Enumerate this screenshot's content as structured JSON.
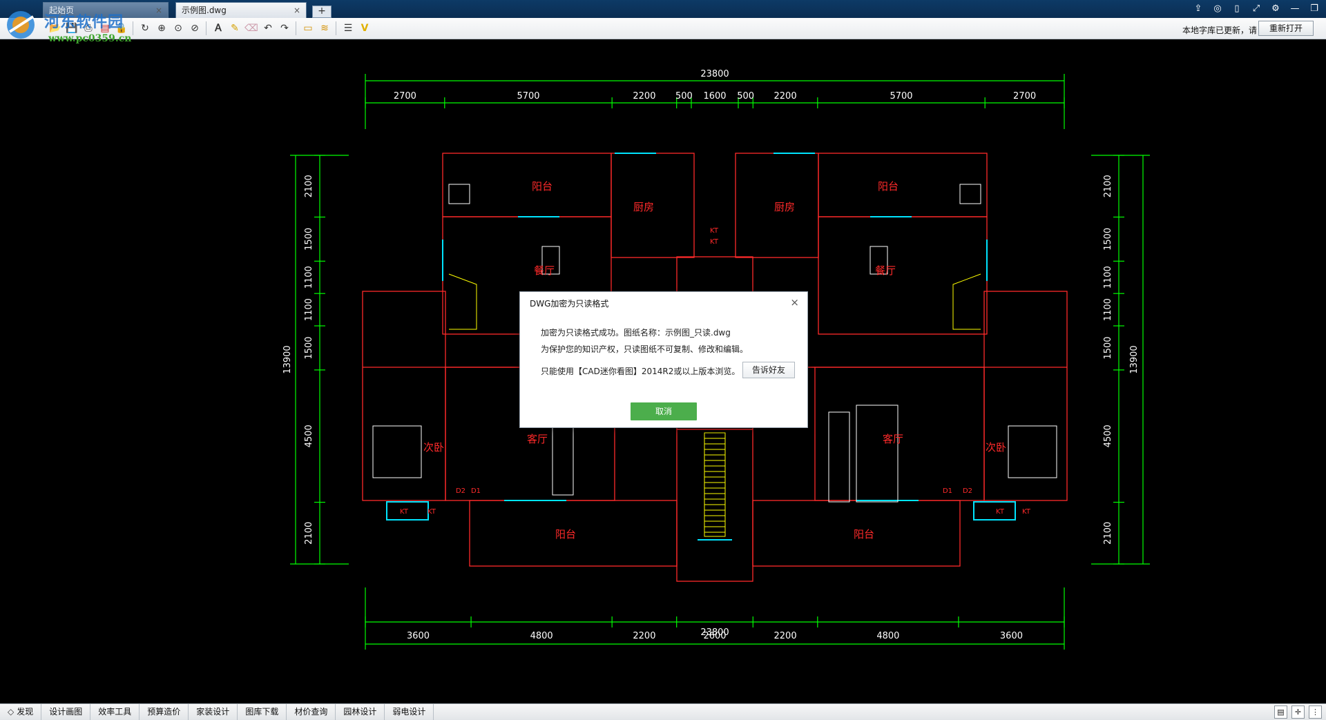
{
  "titlebar": {
    "tabs": [
      {
        "label": "起始页",
        "close": "×"
      },
      {
        "label": "示例图.dwg",
        "close": "×"
      }
    ],
    "new_tab": "+"
  },
  "watermark": {
    "title": "河东软件园",
    "url": "www.pc0359.cn"
  },
  "toolbar": {
    "notice": "本地字库已更新，请",
    "reopen": "重新打开"
  },
  "drawing": {
    "colors": {
      "background": "#000000",
      "dimension": "#00ff00",
      "wall": "#ff2a2a",
      "window": "#00e5ff",
      "furniture": "#ffffff",
      "stair": "#ffff00",
      "dim_text": "#ffffff",
      "room_text": "#ff2a2a"
    },
    "top_total": "23800",
    "top_dims": [
      "2700",
      "5700",
      "2200",
      "500",
      "1600",
      "500",
      "2200",
      "5700",
      "2700"
    ],
    "bottom_dims": [
      "3600",
      "4800",
      "2200",
      "2600",
      "2200",
      "4800",
      "3600"
    ],
    "bottom_total": "23800",
    "left_dims": [
      "2100",
      "1500",
      "1100",
      "1100",
      "1500",
      "4500",
      "2100"
    ],
    "left_total": "13900",
    "right_dims": [
      "2100",
      "1500",
      "1100",
      "1100",
      "1500",
      "4500",
      "2100"
    ],
    "right_total": "13900",
    "rooms": {
      "balcony": "阳台",
      "kitchen": "厨房",
      "dining": "餐厅",
      "living": "客厅",
      "bedroom": "次卧"
    },
    "tags": {
      "kt": "KT",
      "d1": "D1",
      "d2": "D2"
    }
  },
  "dialog": {
    "title": "DWG加密为只读格式",
    "close": "×",
    "line1": "加密为只读格式成功。图纸名称：示例图_只读.dwg",
    "line2": "为保护您的知识产权，只读图纸不可复制、修改和编辑。",
    "line3": "只能使用【CAD迷你看图】2014R2或以上版本浏览。",
    "share_button": "告诉好友",
    "cancel_button": "取消"
  },
  "bottombar": {
    "items": [
      "发现",
      "设计画图",
      "效率工具",
      "预算造价",
      "家装设计",
      "图库下载",
      "材价查询",
      "园林设计",
      "弱电设计"
    ]
  },
  "icons": {
    "toolbar": [
      "open-icon",
      "save-icon",
      "print-icon",
      "pdf-icon",
      "lock-icon",
      "rotate-icon",
      "zoom-window-icon",
      "zoom-extents-icon",
      "zoom-realtime-icon",
      "text-icon",
      "pencil-icon",
      "eraser-icon",
      "undo-icon",
      "redo-icon",
      "measure-icon",
      "hatch-icon",
      "layers-icon",
      "check-icon"
    ],
    "window": [
      "share-icon",
      "wechat-icon",
      "phone-icon",
      "fullscreen-icon",
      "settings-icon",
      "minimize-icon",
      "restore-icon"
    ]
  }
}
